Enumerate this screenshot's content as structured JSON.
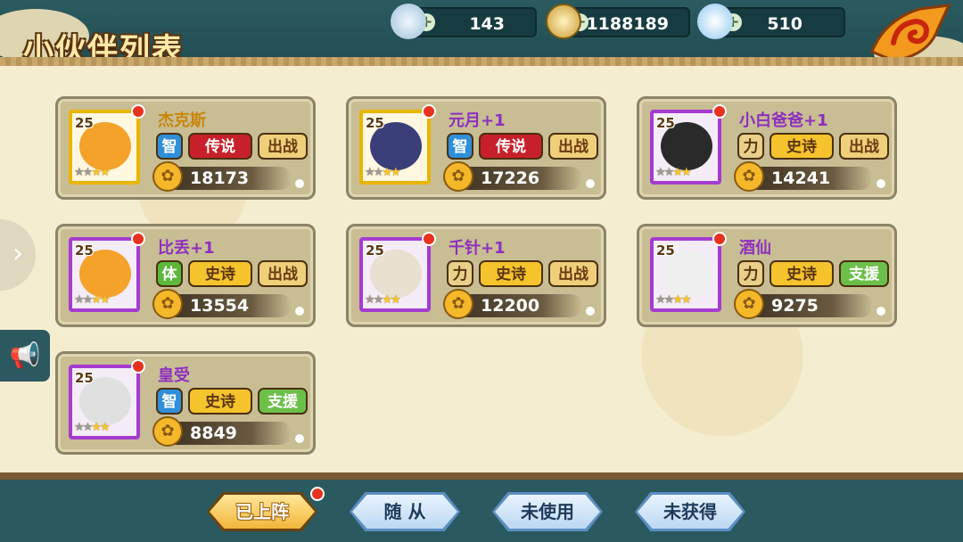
{
  "header": {
    "title": "小伙伴列表",
    "resources": [
      {
        "name": "stamina",
        "icon": "sword-crystal-icon",
        "value": "143"
      },
      {
        "name": "coins",
        "icon": "coin-icon",
        "value": "1188189"
      },
      {
        "name": "gems",
        "icon": "diamond-icon",
        "value": "510"
      }
    ],
    "plus_symbol": "+"
  },
  "cards": [
    {
      "name": "杰克斯",
      "level": "25",
      "attribute": "智",
      "rarity": "传说",
      "role": "出战",
      "power": "18173",
      "stars": 4,
      "filled_stars": 2
    },
    {
      "name": "元月+1",
      "level": "25",
      "attribute": "智",
      "rarity": "传说",
      "role": "出战",
      "power": "17226",
      "stars": 4,
      "filled_stars": 2
    },
    {
      "name": "小白爸爸+1",
      "level": "25",
      "attribute": "力",
      "rarity": "史诗",
      "role": "出战",
      "power": "14241",
      "stars": 4,
      "filled_stars": 2
    },
    {
      "name": "比丢+1",
      "level": "25",
      "attribute": "体",
      "rarity": "史诗",
      "role": "出战",
      "power": "13554",
      "stars": 4,
      "filled_stars": 2
    },
    {
      "name": "千针+1",
      "level": "25",
      "attribute": "力",
      "rarity": "史诗",
      "role": "出战",
      "power": "12200",
      "stars": 4,
      "filled_stars": 2
    },
    {
      "name": "酒仙",
      "level": "25",
      "attribute": "力",
      "rarity": "史诗",
      "role": "支援",
      "power": "9275",
      "stars": 4,
      "filled_stars": 2
    },
    {
      "name": "皇受",
      "level": "25",
      "attribute": "智",
      "rarity": "史诗",
      "role": "支援",
      "power": "8849",
      "stars": 4,
      "filled_stars": 2
    }
  ],
  "tabs": [
    {
      "label": "已上阵",
      "active": true
    },
    {
      "label": "随 从",
      "active": false
    },
    {
      "label": "未使用",
      "active": false
    },
    {
      "label": "未获得",
      "active": false
    }
  ],
  "side": {
    "arrow": "›",
    "speaker_icon": "📢"
  },
  "colors": {
    "legend": "#c8202a",
    "epic": "#f5c32c",
    "support": "#6cc04a",
    "zhi": "#2f8fd8"
  }
}
